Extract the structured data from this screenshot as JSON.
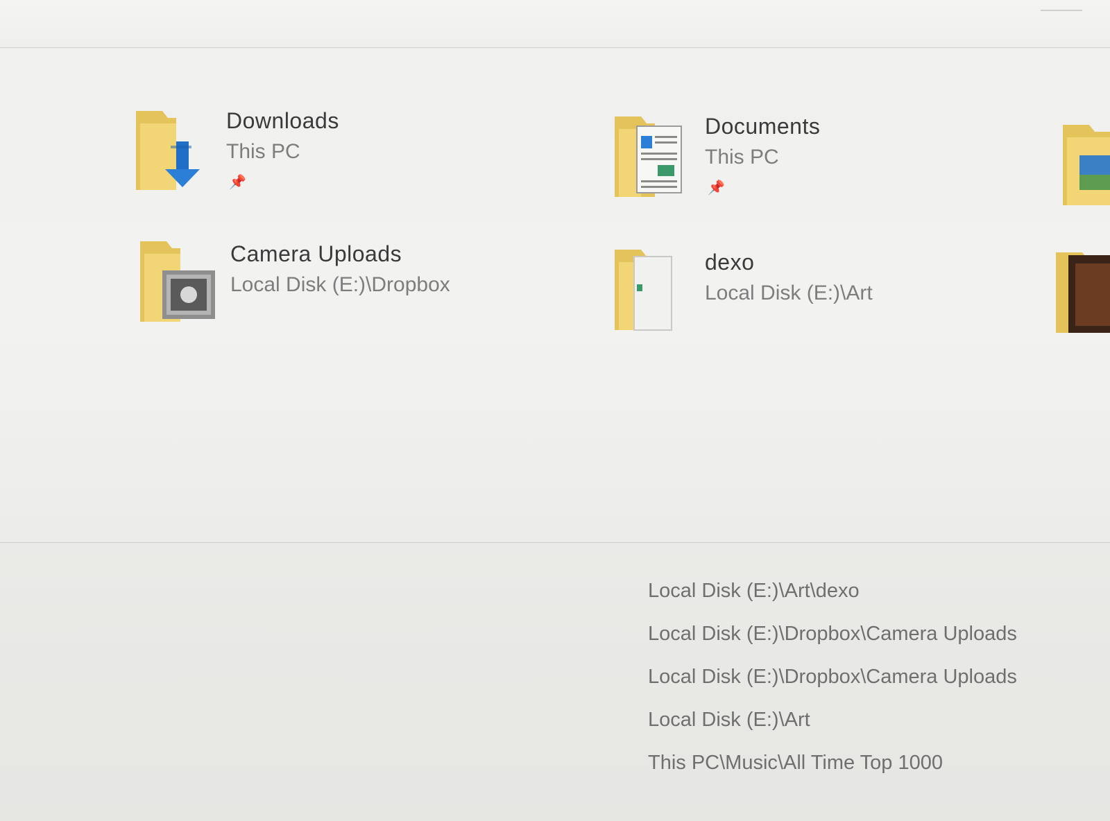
{
  "quick_access": {
    "items": [
      {
        "name": "Downloads",
        "location": "This PC",
        "pinned": true,
        "icon": "downloads-folder-icon"
      },
      {
        "name": "Documents",
        "location": "This PC",
        "pinned": true,
        "icon": "documents-folder-icon"
      },
      {
        "name": "Camera Uploads",
        "location": "Local Disk (E:)\\Dropbox",
        "pinned": false,
        "icon": "camera-uploads-folder-icon"
      },
      {
        "name": "dexo",
        "location": "Local Disk (E:)\\Art",
        "pinned": false,
        "icon": "dexo-folder-icon"
      }
    ],
    "pin_glyph": "📌"
  },
  "recent_files": {
    "locations": [
      "Local Disk (E:)\\Art\\dexo",
      "Local Disk (E:)\\Dropbox\\Camera Uploads",
      "Local Disk (E:)\\Dropbox\\Camera Uploads",
      "Local Disk (E:)\\Art",
      "This PC\\Music\\All Time Top 1000"
    ]
  },
  "colors": {
    "folder_yellow": "#f2d675",
    "folder_dark": "#d9b548",
    "download_arrow": "#2b7fd6"
  }
}
